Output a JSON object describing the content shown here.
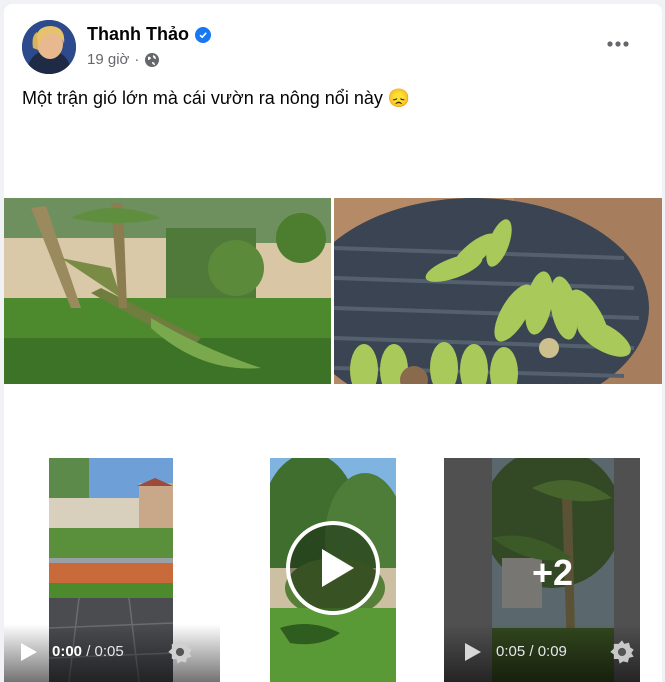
{
  "post": {
    "author": "Thanh Thảo",
    "time": "19 giờ",
    "caption": "Một trận gió lớn mà cái vườn ra nông nổi này 😞"
  },
  "media": {
    "video1": {
      "current": "0:00",
      "total": " / 0:05"
    },
    "video3": {
      "current": "0:05",
      "total": " / 0:09",
      "more_count": "+2"
    }
  },
  "icons": {
    "verified": "verified-badge-icon",
    "audience": "globe-icon",
    "more": "more-options-icon",
    "play": "play-icon",
    "settings": "gear-icon"
  },
  "colors": {
    "accent": "#1877f2",
    "text": "#050505",
    "secondary": "#65676b"
  }
}
